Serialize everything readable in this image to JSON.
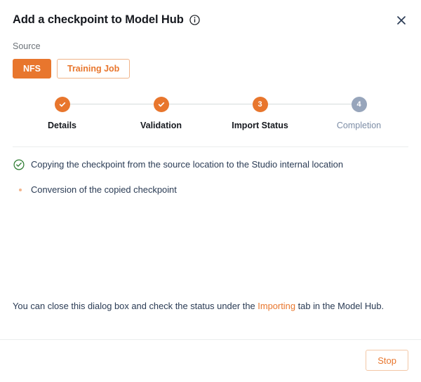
{
  "dialog": {
    "title": "Add a checkpoint to Model Hub",
    "info_icon": "info-circle-icon",
    "close_icon": "close-icon"
  },
  "source": {
    "label": "Source",
    "options": [
      {
        "label": "NFS",
        "selected": true
      },
      {
        "label": "Training Job",
        "selected": false
      }
    ]
  },
  "stepper": {
    "steps": [
      {
        "number": "1",
        "label": "Details",
        "state": "done",
        "glyph": "check-icon"
      },
      {
        "number": "2",
        "label": "Validation",
        "state": "done",
        "glyph": "check-icon"
      },
      {
        "number": "3",
        "label": "Import Status",
        "state": "current",
        "glyph": "3"
      },
      {
        "number": "4",
        "label": "Completion",
        "state": "upcoming",
        "glyph": "4"
      }
    ]
  },
  "status": {
    "items": [
      {
        "text": "Copying the checkpoint from the source location to the Studio internal location",
        "state": "complete",
        "icon": "check-circle-icon"
      },
      {
        "text": "Conversion of the copied checkpoint",
        "state": "in-progress",
        "icon": "spinner-icon"
      }
    ]
  },
  "footer": {
    "note_prefix": "You can close this dialog box and check the status under the ",
    "note_link": "Importing",
    "note_suffix": " tab in the Model Hub.",
    "stop_label": "Stop"
  },
  "colors": {
    "accent": "#e8762d",
    "accent_border": "#f0b48a",
    "success": "#2e7d32",
    "upcoming_step": "#97a5bb",
    "text_dark": "#16191f",
    "text_body": "#2a3b54",
    "text_muted": "#6c7278",
    "divider": "#eaeded"
  }
}
